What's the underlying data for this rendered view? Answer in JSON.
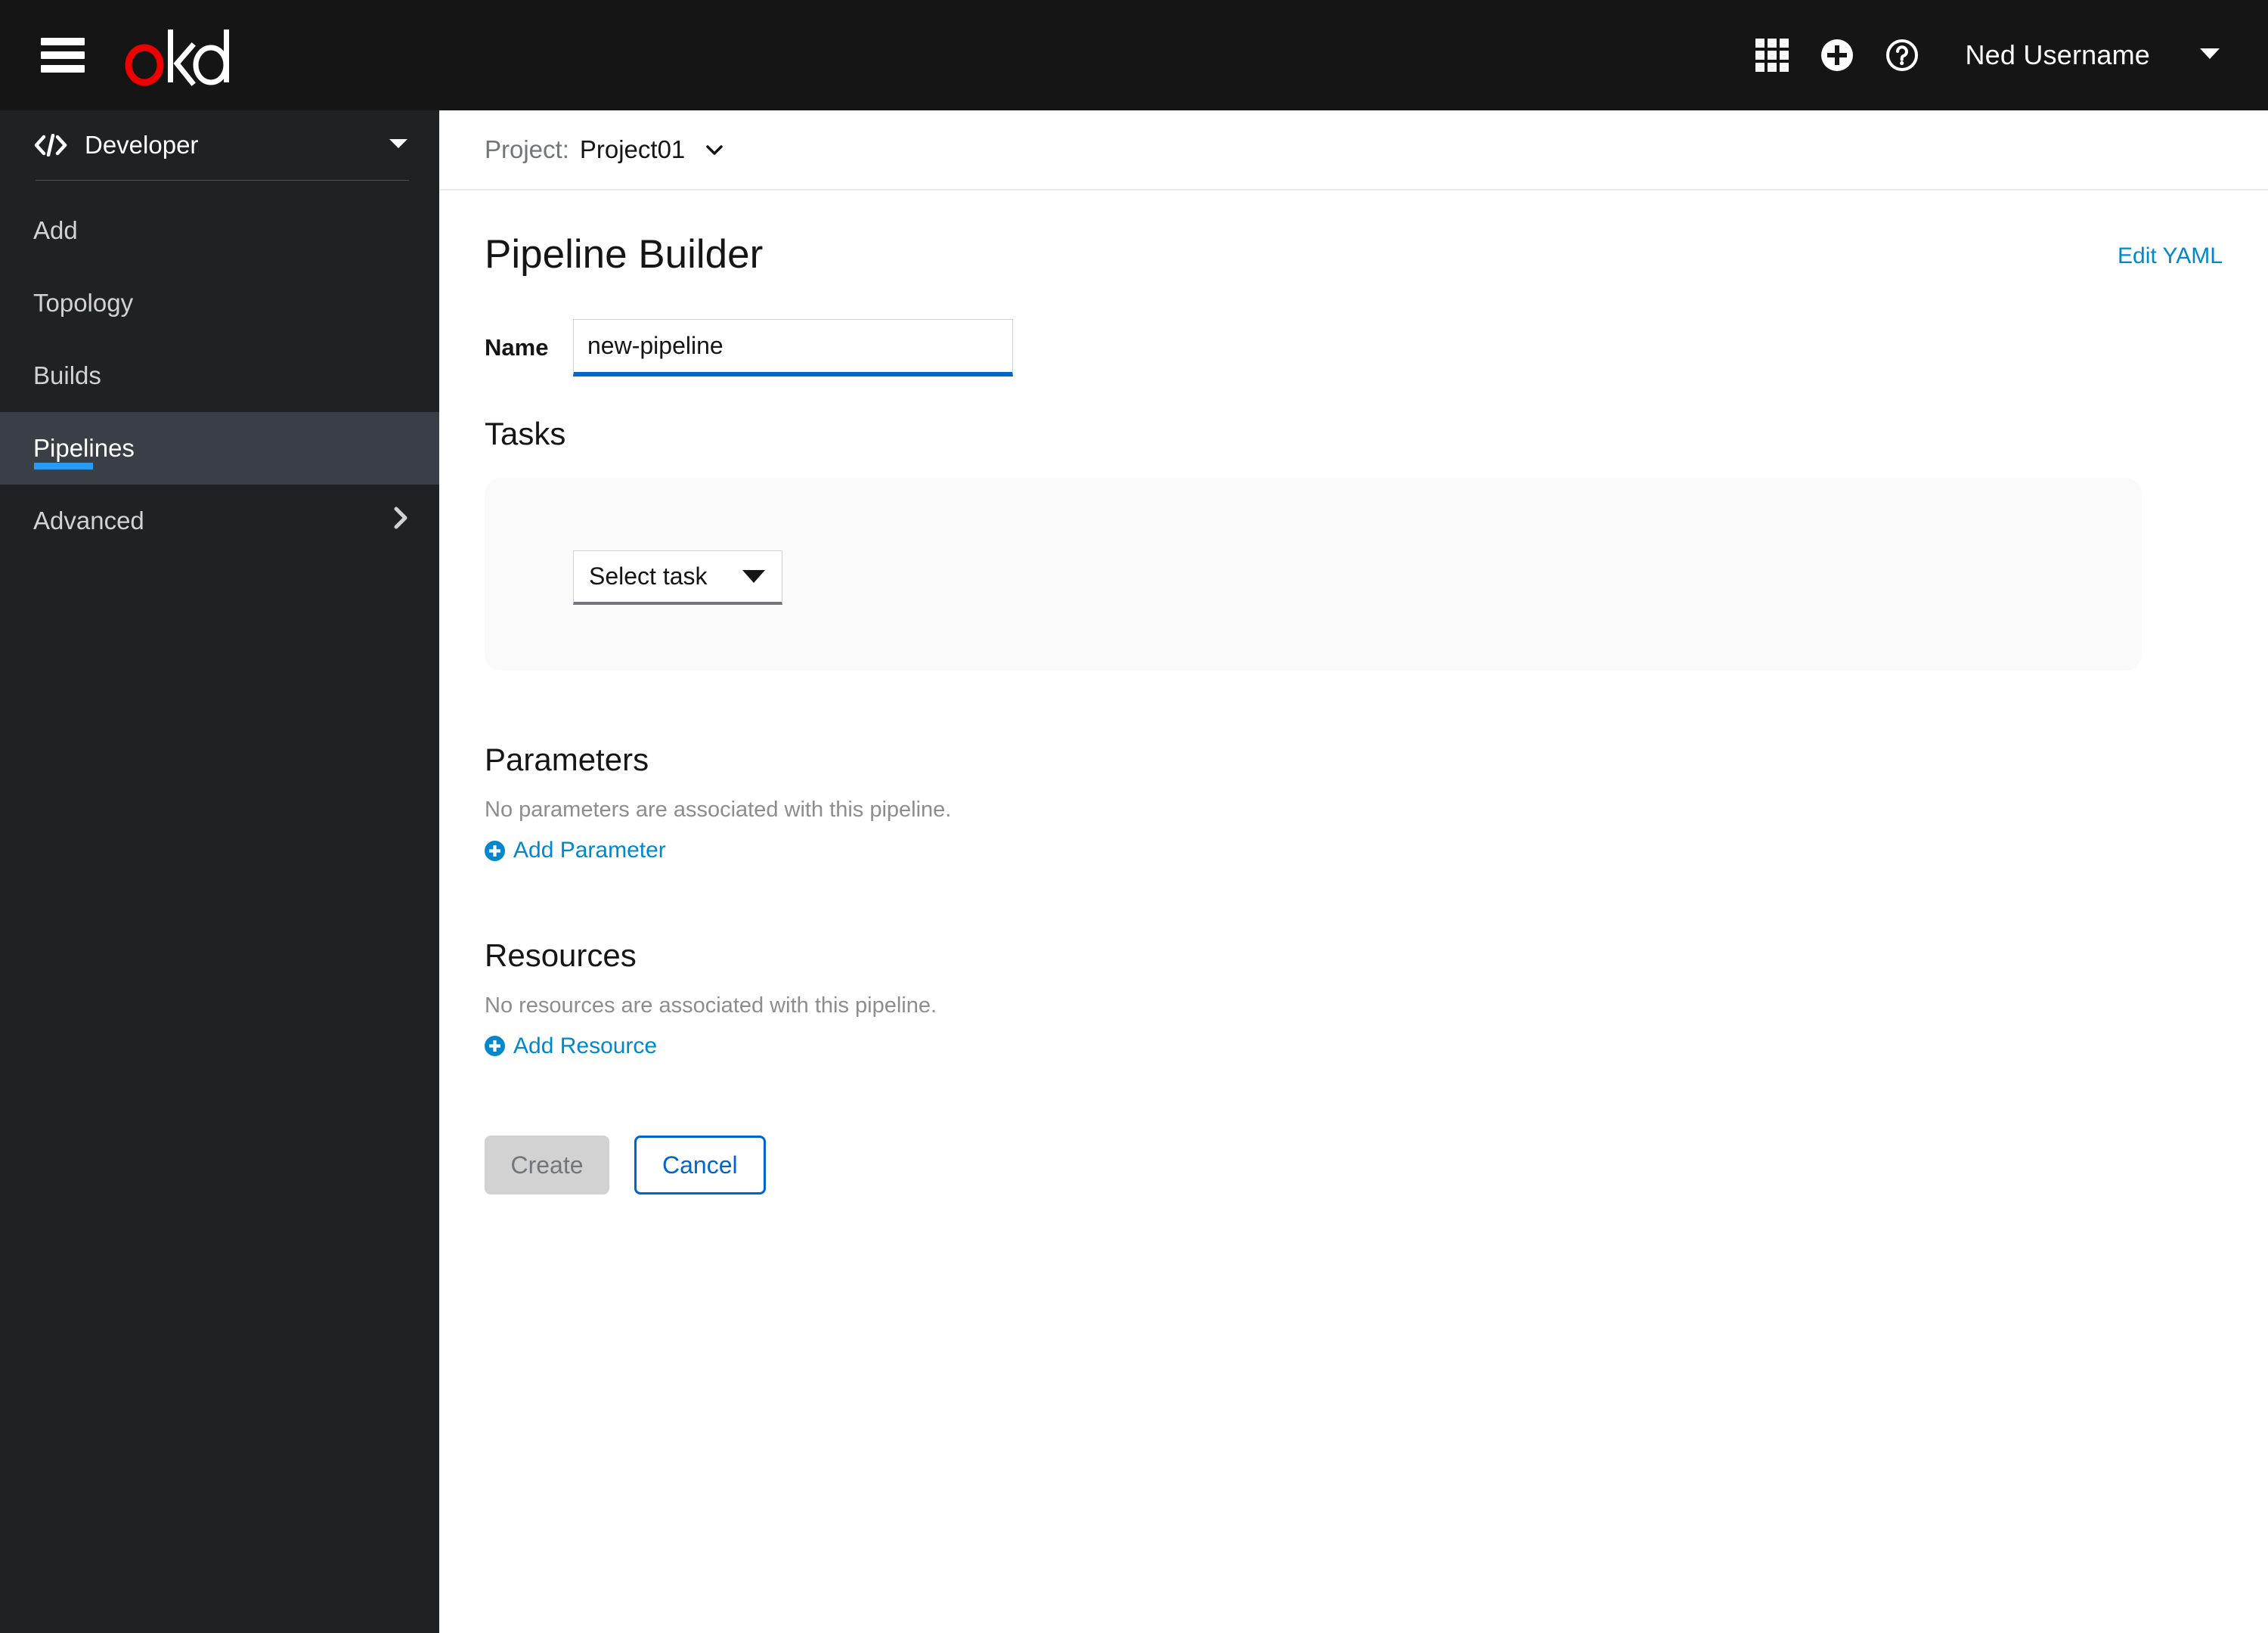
{
  "masthead": {
    "menu_icon": "hamburger-icon",
    "brand": "okd",
    "brand_colors": {
      "o": "#ee0000",
      "kd": "#ffffff"
    },
    "apps_icon": "grid-apps-icon",
    "add_icon": "plus-circle-icon",
    "help_icon": "question-circle-icon",
    "user_name": "Ned Username",
    "user_caret_icon": "caret-down-icon",
    "background": "#151515"
  },
  "sidebar": {
    "background": "#1f2225",
    "perspective": {
      "icon": "code-icon",
      "label": "Developer",
      "caret_icon": "caret-down-icon"
    },
    "items": [
      {
        "label": "Add",
        "active": false
      },
      {
        "label": "Topology",
        "active": false
      },
      {
        "label": "Builds",
        "active": false
      },
      {
        "label": "Pipelines",
        "active": true
      },
      {
        "label": "Advanced",
        "active": false,
        "chevron_icon": "chevron-right-icon"
      }
    ],
    "active_accent": "#2b9af3",
    "active_background": "#393f44"
  },
  "project_bar": {
    "label": "Project:",
    "value": "Project01",
    "caret_icon": "chevron-down-icon"
  },
  "page": {
    "title": "Pipeline Builder",
    "edit_yaml": "Edit YAML",
    "link_color": "#0088ce"
  },
  "form": {
    "name": {
      "label": "Name",
      "value": "new-pipeline",
      "placeholder": "",
      "focus_color": "#0066cc"
    },
    "tasks": {
      "heading": "Tasks",
      "select_task_label": "Select task",
      "select_task_caret": "caret-down-icon",
      "panel_background": "#fafafa"
    },
    "parameters": {
      "heading": "Parameters",
      "empty_text": "No parameters are associated with this pipeline.",
      "add_label": "Add Parameter",
      "add_icon": "plus-circle-filled-icon"
    },
    "resources": {
      "heading": "Resources",
      "empty_text": "No resources are associated with this pipeline.",
      "add_label": "Add Resource",
      "add_icon": "plus-circle-filled-icon"
    },
    "actions": {
      "create_label": "Create",
      "create_disabled": true,
      "cancel_label": "Cancel",
      "primary_color": "#0066cc"
    }
  }
}
